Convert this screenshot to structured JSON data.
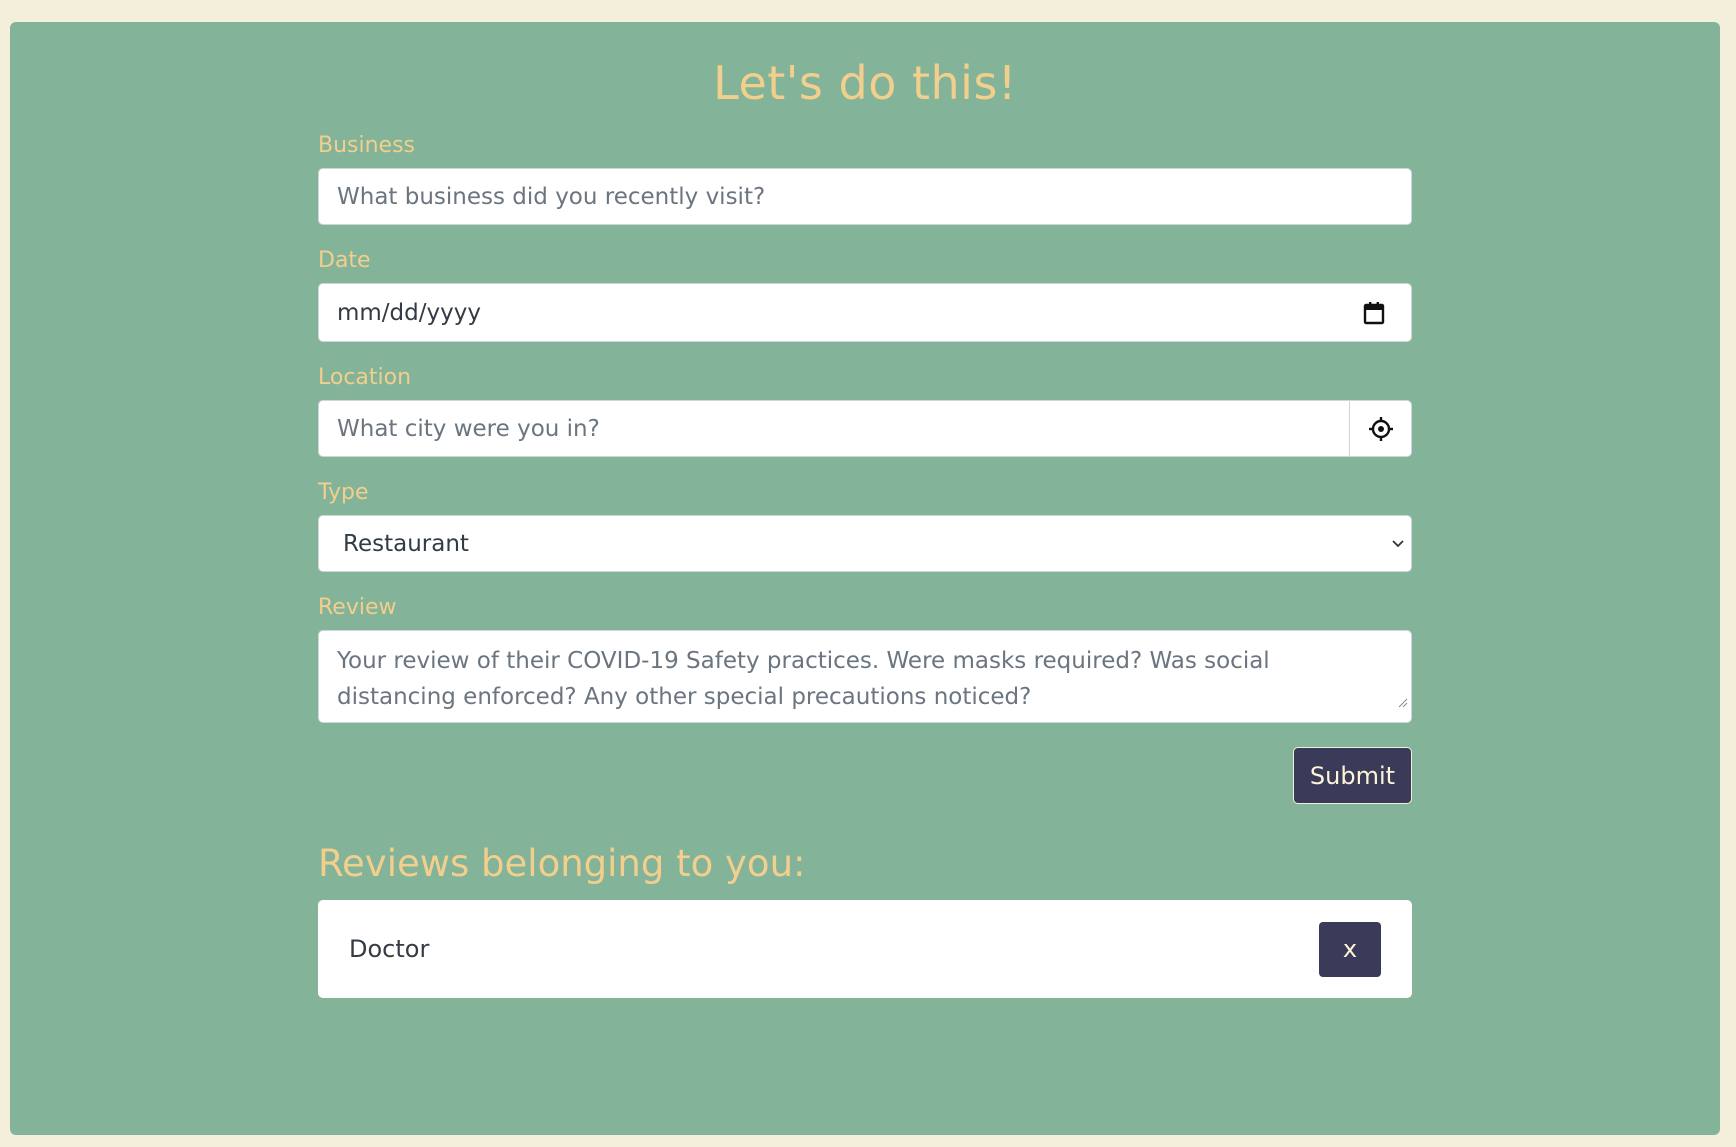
{
  "header": {
    "title": "Let's do this!"
  },
  "form": {
    "business": {
      "label": "Business",
      "placeholder": "What business did you recently visit?"
    },
    "date": {
      "label": "Date",
      "value": "mm/dd/yyyy"
    },
    "location": {
      "label": "Location",
      "placeholder": "What city were you in?"
    },
    "type": {
      "label": "Type",
      "selected": "Restaurant"
    },
    "review": {
      "label": "Review",
      "placeholder": "Your review of their COVID-19 Safety practices. Were masks required? Was social distancing enforced? Any other special precautions noticed?"
    },
    "submit_label": "Submit"
  },
  "reviews": {
    "title": "Reviews belonging to you:",
    "items": [
      {
        "name": "Doctor",
        "delete_label": "x"
      }
    ]
  },
  "colors": {
    "page_bg": "#f4efdb",
    "panel_bg": "#83b399",
    "accent_text": "#f2cf8c",
    "button_bg": "#3a3b59"
  },
  "icons": {
    "date": "calendar-icon",
    "location": "crosshair-icon",
    "select": "chevron-down-icon"
  }
}
